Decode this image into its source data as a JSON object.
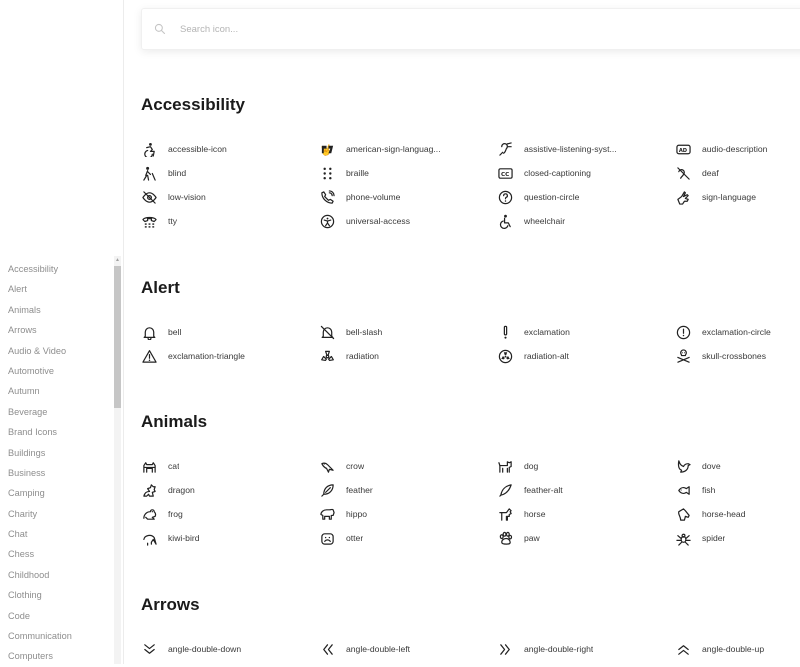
{
  "search": {
    "placeholder": "Search icon..."
  },
  "sidebar": {
    "items": [
      "Accessibility",
      "Alert",
      "Animals",
      "Arrows",
      "Audio & Video",
      "Automotive",
      "Autumn",
      "Beverage",
      "Brand Icons",
      "Buildings",
      "Business",
      "Camping",
      "Charity",
      "Chat",
      "Chess",
      "Childhood",
      "Clothing",
      "Code",
      "Communication",
      "Computers"
    ]
  },
  "sections": [
    {
      "title": "Accessibility",
      "icons": [
        {
          "label": "accessible-icon",
          "icon": "accessible-icon"
        },
        {
          "label": "american-sign-languag...",
          "icon": "asl-icon"
        },
        {
          "label": "assistive-listening-syst...",
          "icon": "assistive-listening-icon"
        },
        {
          "label": "audio-description",
          "icon": "audio-description-icon"
        },
        {
          "label": "blind",
          "icon": "blind-icon"
        },
        {
          "label": "braille",
          "icon": "braille-icon"
        },
        {
          "label": "closed-captioning",
          "icon": "closed-captioning-icon"
        },
        {
          "label": "deaf",
          "icon": "deaf-icon"
        },
        {
          "label": "low-vision",
          "icon": "low-vision-icon"
        },
        {
          "label": "phone-volume",
          "icon": "phone-volume-icon"
        },
        {
          "label": "question-circle",
          "icon": "question-circle-icon"
        },
        {
          "label": "sign-language",
          "icon": "sign-language-icon"
        },
        {
          "label": "tty",
          "icon": "tty-icon"
        },
        {
          "label": "universal-access",
          "icon": "universal-access-icon"
        },
        {
          "label": "wheelchair",
          "icon": "wheelchair-icon"
        }
      ]
    },
    {
      "title": "Alert",
      "icons": [
        {
          "label": "bell",
          "icon": "bell-icon"
        },
        {
          "label": "bell-slash",
          "icon": "bell-slash-icon"
        },
        {
          "label": "exclamation",
          "icon": "exclamation-icon"
        },
        {
          "label": "exclamation-circle",
          "icon": "exclamation-circle-icon"
        },
        {
          "label": "exclamation-triangle",
          "icon": "exclamation-triangle-icon"
        },
        {
          "label": "radiation",
          "icon": "radiation-icon"
        },
        {
          "label": "radiation-alt",
          "icon": "radiation-alt-icon"
        },
        {
          "label": "skull-crossbones",
          "icon": "skull-crossbones-icon"
        }
      ]
    },
    {
      "title": "Animals",
      "icons": [
        {
          "label": "cat",
          "icon": "cat-icon"
        },
        {
          "label": "crow",
          "icon": "crow-icon"
        },
        {
          "label": "dog",
          "icon": "dog-icon"
        },
        {
          "label": "dove",
          "icon": "dove-icon"
        },
        {
          "label": "dragon",
          "icon": "dragon-icon"
        },
        {
          "label": "feather",
          "icon": "feather-icon"
        },
        {
          "label": "feather-alt",
          "icon": "feather-alt-icon"
        },
        {
          "label": "fish",
          "icon": "fish-icon"
        },
        {
          "label": "frog",
          "icon": "frog-icon"
        },
        {
          "label": "hippo",
          "icon": "hippo-icon"
        },
        {
          "label": "horse",
          "icon": "horse-icon"
        },
        {
          "label": "horse-head",
          "icon": "horse-head-icon"
        },
        {
          "label": "kiwi-bird",
          "icon": "kiwi-bird-icon"
        },
        {
          "label": "otter",
          "icon": "otter-icon"
        },
        {
          "label": "paw",
          "icon": "paw-icon"
        },
        {
          "label": "spider",
          "icon": "spider-icon"
        }
      ]
    },
    {
      "title": "Arrows",
      "icons": [
        {
          "label": "angle-double-down",
          "icon": "angle-double-down-icon"
        },
        {
          "label": "angle-double-left",
          "icon": "angle-double-left-icon"
        },
        {
          "label": "angle-double-right",
          "icon": "angle-double-right-icon"
        },
        {
          "label": "angle-double-up",
          "icon": "angle-double-up-icon"
        }
      ]
    }
  ]
}
